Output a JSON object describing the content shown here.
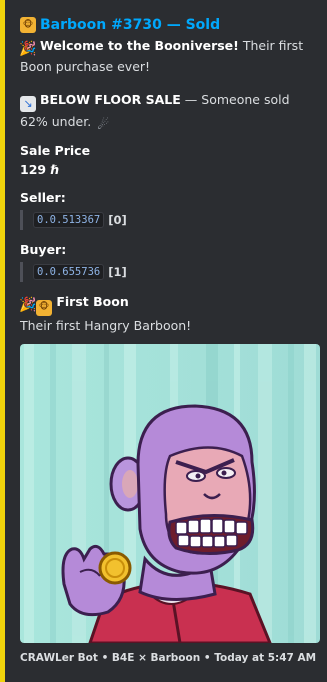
{
  "embed": {
    "accent_color": "#f0d30c",
    "title": "Barboon #3730 — Sold",
    "title_icon": "monkey-emoji-icon",
    "welcome": {
      "icon": "party-popper-icon",
      "bold": "Welcome to the Booniverse!",
      "text": " Their first Boon purchase ever!"
    },
    "below_floor": {
      "icon": "chart-decreasing-icon",
      "bold": "BELOW FLOOR SALE",
      "text": " — Someone sold 62% under.",
      "trail_icon": "comet-icon"
    },
    "sale_price": {
      "label": "Sale Price",
      "value": "129 ℏ"
    },
    "seller": {
      "label": "Seller:",
      "account": "0.0.513367",
      "count": "[0]"
    },
    "buyer": {
      "label": "Buyer:",
      "account": "0.0.655736",
      "count": "[1]"
    },
    "first_boon": {
      "icons": [
        "party-popper-icon",
        "monkey-emoji-icon"
      ],
      "bold": "First Boon",
      "text": "Their first Hangry Barboon!"
    },
    "image": {
      "subject": "purple-barboon-ape-holding-gold-coin"
    },
    "footer": "CRAWLer Bot • B4E × Barboon • Today at 5:47 AM"
  }
}
